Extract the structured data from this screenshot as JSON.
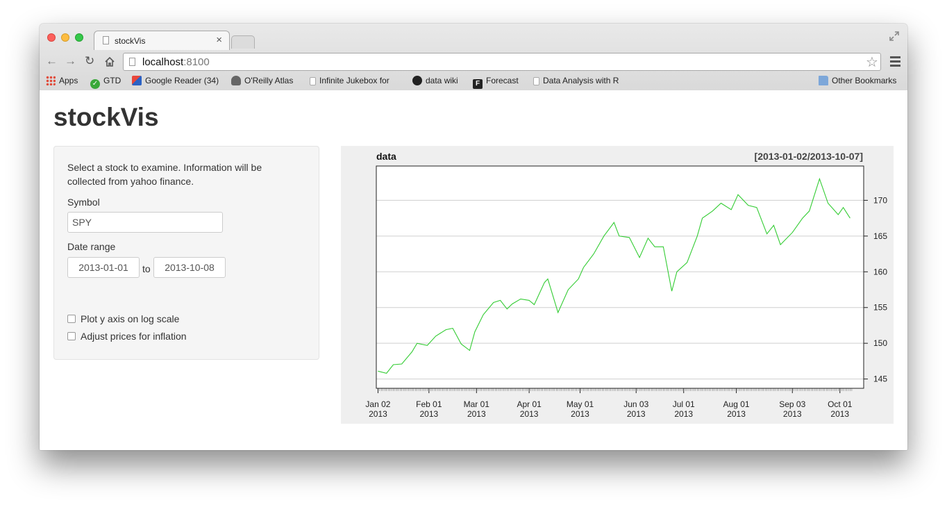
{
  "browser": {
    "tab_title": "stockVis",
    "tab_close": "×",
    "url_host": "localhost",
    "url_port": ":8100",
    "nav_icons": [
      "back-icon",
      "forward-icon",
      "reload-icon",
      "home-icon"
    ],
    "bookmarks": [
      {
        "label": "Apps",
        "icon": "apps-icon",
        "color": "#e04b3a"
      },
      {
        "label": "GTD",
        "icon": "check-icon",
        "color": "#3aa83a"
      },
      {
        "label": "Google Reader (34)",
        "icon": "reader-icon",
        "color": "#2b62c4"
      },
      {
        "label": "O'Reilly Atlas",
        "icon": "atlas-icon",
        "color": "#555555"
      },
      {
        "label": "Infinite Jukebox for ",
        "icon": "page-icon",
        "color": "#ffffff"
      },
      {
        "label": "data wiki",
        "icon": "github-icon",
        "color": "#222222"
      },
      {
        "label": "Forecast",
        "icon": "forecast-icon",
        "color": "#222222"
      },
      {
        "label": "Data Analysis with R",
        "icon": "page-icon",
        "color": "#ffffff"
      }
    ],
    "other_bookmarks": "Other Bookmarks"
  },
  "app": {
    "title": "stockVis",
    "help_text": "Select a stock to examine. Information will be collected from yahoo finance.",
    "symbol_label": "Symbol",
    "symbol_value": "SPY",
    "date_label": "Date range",
    "date_from": "2013-01-01",
    "date_sep": "to",
    "date_to": "2013-10-08",
    "log_label": "Plot y axis on log scale",
    "log_checked": false,
    "adjust_label": "Adjust prices for inflation",
    "adjust_checked": false
  },
  "chart_data": {
    "type": "line",
    "title": "data",
    "subtitle": "[2013-01-02/2013-10-07]",
    "series": [
      {
        "color": "#33cc33",
        "points": [
          [
            "2013-01-02",
            146.1
          ],
          [
            "2013-01-07",
            145.8
          ],
          [
            "2013-01-11",
            147.0
          ],
          [
            "2013-01-16",
            147.1
          ],
          [
            "2013-01-22",
            148.8
          ],
          [
            "2013-01-25",
            150.0
          ],
          [
            "2013-01-31",
            149.7
          ],
          [
            "2013-02-05",
            151.0
          ],
          [
            "2013-02-11",
            151.9
          ],
          [
            "2013-02-15",
            152.1
          ],
          [
            "2013-02-20",
            149.9
          ],
          [
            "2013-02-25",
            149.0
          ],
          [
            "2013-02-28",
            151.6
          ],
          [
            "2013-03-05",
            154.0
          ],
          [
            "2013-03-11",
            155.7
          ],
          [
            "2013-03-15",
            156.0
          ],
          [
            "2013-03-19",
            154.8
          ],
          [
            "2013-03-22",
            155.5
          ],
          [
            "2013-03-27",
            156.2
          ],
          [
            "2013-04-01",
            156.0
          ],
          [
            "2013-04-04",
            155.4
          ],
          [
            "2013-04-10",
            158.5
          ],
          [
            "2013-04-12",
            159.0
          ],
          [
            "2013-04-18",
            154.3
          ],
          [
            "2013-04-24",
            157.5
          ],
          [
            "2013-04-30",
            159.0
          ],
          [
            "2013-05-03",
            160.6
          ],
          [
            "2013-05-09",
            162.5
          ],
          [
            "2013-05-15",
            165.0
          ],
          [
            "2013-05-21",
            166.9
          ],
          [
            "2013-05-24",
            165.0
          ],
          [
            "2013-05-30",
            164.8
          ],
          [
            "2013-06-05",
            162.0
          ],
          [
            "2013-06-10",
            164.7
          ],
          [
            "2013-06-14",
            163.5
          ],
          [
            "2013-06-19",
            163.5
          ],
          [
            "2013-06-24",
            157.3
          ],
          [
            "2013-06-27",
            160.0
          ],
          [
            "2013-07-03",
            161.3
          ],
          [
            "2013-07-09",
            165.0
          ],
          [
            "2013-07-12",
            167.5
          ],
          [
            "2013-07-18",
            168.5
          ],
          [
            "2013-07-23",
            169.6
          ],
          [
            "2013-07-29",
            168.7
          ],
          [
            "2013-08-02",
            170.8
          ],
          [
            "2013-08-08",
            169.3
          ],
          [
            "2013-08-13",
            169.0
          ],
          [
            "2013-08-19",
            165.3
          ],
          [
            "2013-08-23",
            166.5
          ],
          [
            "2013-08-27",
            163.8
          ],
          [
            "2013-09-03",
            165.5
          ],
          [
            "2013-09-09",
            167.5
          ],
          [
            "2013-09-13",
            168.5
          ],
          [
            "2013-09-19",
            173.0
          ],
          [
            "2013-09-24",
            169.6
          ],
          [
            "2013-09-30",
            168.0
          ],
          [
            "2013-10-03",
            169.0
          ],
          [
            "2013-10-07",
            167.5
          ]
        ]
      }
    ],
    "x_ticks": [
      {
        "date": "2013-01-02",
        "label": "Jan 02\n2013"
      },
      {
        "date": "2013-02-01",
        "label": "Feb 01\n2013"
      },
      {
        "date": "2013-03-01",
        "label": "Mar 01\n2013"
      },
      {
        "date": "2013-04-01",
        "label": "Apr 01\n2013"
      },
      {
        "date": "2013-05-01",
        "label": "May 01\n2013"
      },
      {
        "date": "2013-06-03",
        "label": "Jun 03\n2013"
      },
      {
        "date": "2013-07-01",
        "label": "Jul 01\n2013"
      },
      {
        "date": "2013-08-01",
        "label": "Aug 01\n2013"
      },
      {
        "date": "2013-09-03",
        "label": "Sep 03\n2013"
      },
      {
        "date": "2013-10-01",
        "label": "Oct 01\n2013"
      }
    ],
    "y_ticks": [
      145,
      150,
      155,
      160,
      165,
      170
    ],
    "ylim": [
      143.7,
      174.8
    ],
    "xlim": [
      "2013-01-01",
      "2013-10-15"
    ],
    "y_axis_side": "right",
    "grid": "horizontal"
  }
}
